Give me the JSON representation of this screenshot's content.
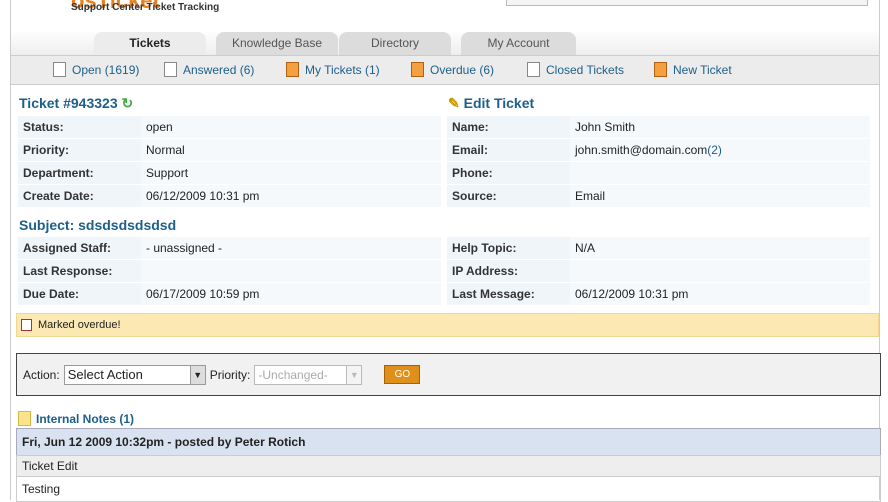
{
  "header": {
    "logo": "osTicket",
    "tagline": "Support Center Ticket Tracking"
  },
  "tabs": [
    {
      "label": "Tickets"
    },
    {
      "label": "Knowledge Base"
    },
    {
      "label": "Directory"
    },
    {
      "label": "My Account"
    }
  ],
  "subnav": [
    {
      "label": "Open (1619)"
    },
    {
      "label": "Answered (6)"
    },
    {
      "label": "My Tickets (1)"
    },
    {
      "label": "Overdue (6)"
    },
    {
      "label": "Closed Tickets"
    },
    {
      "label": "New Ticket"
    }
  ],
  "ticket": {
    "title": "Ticket #943323",
    "edit_label": "Edit Ticket",
    "left": [
      [
        "Status:",
        "open"
      ],
      [
        "Priority:",
        "Normal"
      ],
      [
        "Department:",
        "Support"
      ],
      [
        "Create Date:",
        "06/12/2009 10:31 pm"
      ]
    ],
    "right": [
      [
        "Name:",
        "John Smith"
      ],
      [
        "Email:",
        "john.smith@domain.com"
      ],
      [
        "Phone:",
        ""
      ],
      [
        "Source:",
        "Email"
      ]
    ],
    "email_count": "(2)",
    "subject": "Subject: sdsdsdsdsdsd",
    "left2": [
      [
        "Assigned Staff:",
        "- unassigned -"
      ],
      [
        "Last Response:",
        ""
      ],
      [
        "Due Date:",
        "06/17/2009 10:59 pm"
      ]
    ],
    "right2": [
      [
        "Help Topic:",
        "N/A"
      ],
      [
        "IP Address:",
        ""
      ],
      [
        "Last Message:",
        "06/12/2009 10:31 pm"
      ]
    ]
  },
  "notice": "Marked overdue!",
  "action": {
    "label": "Action:",
    "select": "Select Action",
    "priority_label": "Priority:",
    "priority": "-Unchanged-",
    "go": "GO"
  },
  "notes": {
    "title": "Internal Notes (1)",
    "header": "Fri, Jun 12 2009 10:32pm -  posted by Peter Rotich",
    "subject": "Ticket Edit",
    "body": "Testing"
  }
}
